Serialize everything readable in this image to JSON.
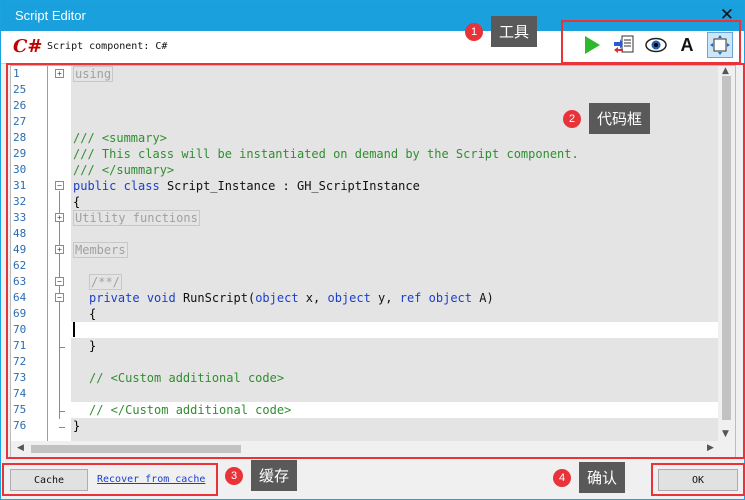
{
  "window": {
    "title": "Script Editor",
    "close_glyph": "✕"
  },
  "toolbar": {
    "logo_text": "C#",
    "component_label": "Script component: C#",
    "tools": [
      {
        "name": "run-icon",
        "color": "#2eb82e"
      },
      {
        "name": "load-code-icon"
      },
      {
        "name": "eye-icon"
      },
      {
        "name": "font-icon",
        "glyph": "A"
      },
      {
        "name": "maximize-icon"
      }
    ]
  },
  "annotations": [
    {
      "num": "1",
      "label": "工具"
    },
    {
      "num": "2",
      "label": "代码框"
    },
    {
      "num": "3",
      "label": "缓存"
    },
    {
      "num": "4",
      "label": "确认"
    }
  ],
  "editor": {
    "lines": [
      {
        "num": "1",
        "text": "using"
      },
      {
        "num": "25",
        "text": ""
      },
      {
        "num": "26",
        "text": ""
      },
      {
        "num": "27",
        "text": ""
      },
      {
        "num": "28",
        "text": "/// <summary>"
      },
      {
        "num": "29",
        "text": "/// This class will be instantiated on demand by the Script component."
      },
      {
        "num": "30",
        "text": "/// </summary>"
      },
      {
        "num": "31",
        "text": "public class Script_Instance : GH_ScriptInstance"
      },
      {
        "num": "32",
        "text": "{"
      },
      {
        "num": "33",
        "text": "Utility functions"
      },
      {
        "num": "48",
        "text": ""
      },
      {
        "num": "49",
        "text": "Members"
      },
      {
        "num": "62",
        "text": ""
      },
      {
        "num": "63",
        "text": "/**/"
      },
      {
        "num": "64",
        "text": "private void RunScript(object x, object y, ref object A)"
      },
      {
        "num": "69",
        "text": "{"
      },
      {
        "num": "70",
        "text": ""
      },
      {
        "num": "71",
        "text": "}"
      },
      {
        "num": "72",
        "text": ""
      },
      {
        "num": "73",
        "text": "// <Custom additional code>"
      },
      {
        "num": "74",
        "text": ""
      },
      {
        "num": "75",
        "text": "// </Custom additional code>"
      },
      {
        "num": "76",
        "text": "}"
      }
    ],
    "tokens": {
      "kw_public": "public",
      "kw_class": "class",
      "class_rest": " Script_Instance : GH_ScriptInstance",
      "kw_private": "private",
      "kw_void": "void",
      "run_name": " RunScript(",
      "kw_object": "object",
      "param_x": " x, ",
      "param_y": " y, ",
      "kw_ref": "ref",
      "param_a": " A)"
    }
  },
  "footer": {
    "cache_label": "Cache",
    "recover_label": "Recover from cache",
    "ok_label": "OK"
  },
  "colors": {
    "accent": "#1aa0dc",
    "annotation": "#e8333a",
    "keyword": "#1b3fc8",
    "comment": "#2f8f2f"
  }
}
